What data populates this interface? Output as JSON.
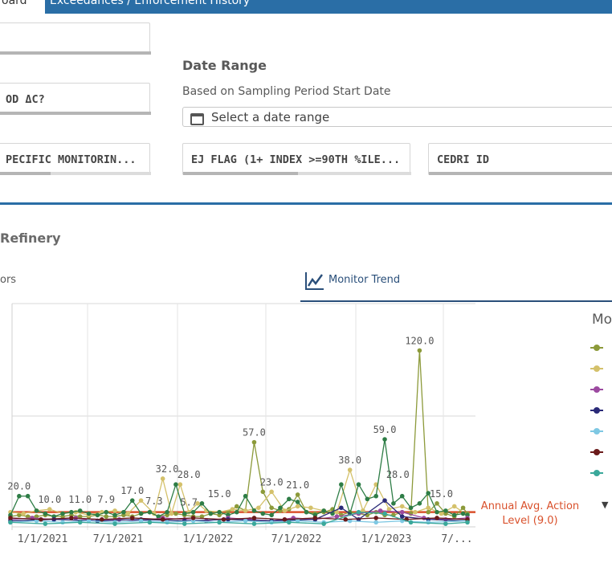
{
  "header": {
    "tab_active": "oard",
    "tab_next": "Exceedances / Enforcement History",
    "accent_color": "#2a6ea6"
  },
  "filters": {
    "box1_label": "",
    "box2_label": "OD ΔC?",
    "box3_label": "PECIFIC MONITORIN...",
    "box4_label": "EJ FLAG (1+ INDEX >=90TH %ILE...",
    "box5_label": "CEDRI ID"
  },
  "date_range": {
    "title": "Date Range",
    "subtitle": "Based on Sampling Period Start Date",
    "placeholder": "Select a date range",
    "icon": "calendar-icon"
  },
  "section": {
    "title": "Refinery",
    "tab_left": "ors",
    "tab_trend": "Monitor Trend",
    "tab_trend_icon": "line-chart-icon"
  },
  "legend": {
    "title": "Mo",
    "items": [
      {
        "color": "#8c9a3a"
      },
      {
        "color": "#d4c16b"
      },
      {
        "color": "#9c4aa0"
      },
      {
        "color": "#2a2a78"
      },
      {
        "color": "#7ec8e3"
      },
      {
        "color": "#6b1a1a"
      },
      {
        "color": "#3aa89a"
      }
    ],
    "more_icon": "caret-down-icon"
  },
  "chart_data": {
    "type": "line",
    "ylim": [
      0,
      150
    ],
    "x_tick_labels": [
      "1/1/2021",
      "7/1/2021",
      "1/1/2022",
      "7/1/2022",
      "1/1/2023",
      "7/..."
    ],
    "reference_line": {
      "label_line1": "Annual Avg. Action",
      "label_line2": "Level (9.0)",
      "value": 9.0,
      "color": "#d9512c"
    },
    "series": [
      {
        "color": "#8c9a3a",
        "values": [
          [
            0,
            6
          ],
          [
            2,
            7
          ],
          [
            4,
            6
          ],
          [
            6,
            6
          ],
          [
            8,
            7
          ],
          [
            10,
            6
          ],
          [
            12,
            6
          ],
          [
            14,
            7
          ],
          [
            16,
            6
          ],
          [
            18,
            6
          ],
          [
            20,
            7
          ],
          [
            22,
            6
          ],
          [
            24,
            6
          ],
          [
            26,
            7
          ],
          [
            28,
            6
          ],
          [
            30,
            8
          ],
          [
            32,
            9
          ],
          [
            34,
            6
          ],
          [
            36,
            7
          ],
          [
            38,
            8
          ],
          [
            40,
            7
          ],
          [
            42,
            6
          ],
          [
            44,
            6
          ],
          [
            46,
            8
          ],
          [
            48,
            7
          ],
          [
            50,
            9
          ],
          [
            52,
            13
          ],
          [
            54,
            10
          ],
          [
            56,
            57
          ],
          [
            58,
            23
          ],
          [
            60,
            12
          ],
          [
            62,
            10
          ],
          [
            64,
            11
          ],
          [
            66,
            21
          ],
          [
            68,
            9
          ],
          [
            70,
            8
          ],
          [
            72,
            9
          ],
          [
            74,
            11
          ],
          [
            76,
            7
          ],
          [
            78,
            9
          ],
          [
            80,
            8
          ],
          [
            82,
            7
          ],
          [
            84,
            9
          ],
          [
            86,
            7
          ],
          [
            88,
            7
          ],
          [
            90,
            9
          ],
          [
            92,
            8
          ],
          [
            94,
            120
          ],
          [
            96,
            9
          ],
          [
            98,
            15
          ],
          [
            100,
            8
          ],
          [
            102,
            6
          ],
          [
            104,
            12
          ],
          [
            105,
            8
          ]
        ]
      },
      {
        "color": "#d4c16b",
        "values": [
          [
            0,
            9
          ],
          [
            3,
            8
          ],
          [
            6,
            10
          ],
          [
            9,
            11
          ],
          [
            12,
            8
          ],
          [
            15,
            9
          ],
          [
            18,
            7
          ],
          [
            21,
            9
          ],
          [
            24,
            10
          ],
          [
            27,
            8
          ],
          [
            30,
            17
          ],
          [
            33,
            8
          ],
          [
            35,
            32
          ],
          [
            37,
            8
          ],
          [
            39,
            28
          ],
          [
            41,
            9
          ],
          [
            43,
            15
          ],
          [
            45,
            10
          ],
          [
            48,
            9
          ],
          [
            51,
            11
          ],
          [
            54,
            10
          ],
          [
            57,
            12
          ],
          [
            60,
            23
          ],
          [
            63,
            10
          ],
          [
            66,
            13
          ],
          [
            69,
            12
          ],
          [
            72,
            10
          ],
          [
            75,
            9
          ],
          [
            78,
            38
          ],
          [
            81,
            10
          ],
          [
            84,
            28
          ],
          [
            87,
            11
          ],
          [
            90,
            13
          ],
          [
            93,
            9
          ],
          [
            96,
            12
          ],
          [
            99,
            8
          ],
          [
            102,
            13
          ],
          [
            105,
            7
          ]
        ]
      },
      {
        "color": "#2e7d46",
        "values": [
          [
            0,
            7
          ],
          [
            2,
            20
          ],
          [
            4,
            20
          ],
          [
            6,
            10
          ],
          [
            8,
            8
          ],
          [
            10,
            6
          ],
          [
            12,
            8
          ],
          [
            14,
            9
          ],
          [
            16,
            10
          ],
          [
            18,
            8
          ],
          [
            20,
            7
          ],
          [
            22,
            9
          ],
          [
            24,
            7
          ],
          [
            26,
            9
          ],
          [
            28,
            17
          ],
          [
            30,
            8
          ],
          [
            32,
            9
          ],
          [
            34,
            6
          ],
          [
            36,
            9
          ],
          [
            38,
            28
          ],
          [
            40,
            8
          ],
          [
            42,
            9
          ],
          [
            44,
            15
          ],
          [
            46,
            8
          ],
          [
            48,
            9
          ],
          [
            50,
            7
          ],
          [
            52,
            9
          ],
          [
            54,
            20
          ],
          [
            56,
            10
          ],
          [
            58,
            8
          ],
          [
            60,
            7
          ],
          [
            62,
            12
          ],
          [
            64,
            18
          ],
          [
            66,
            16
          ],
          [
            68,
            9
          ],
          [
            70,
            7
          ],
          [
            72,
            10
          ],
          [
            74,
            8
          ],
          [
            76,
            28
          ],
          [
            78,
            8
          ],
          [
            80,
            28
          ],
          [
            82,
            18
          ],
          [
            84,
            20
          ],
          [
            86,
            59
          ],
          [
            88,
            15
          ],
          [
            90,
            20
          ],
          [
            92,
            12
          ],
          [
            94,
            15
          ],
          [
            96,
            22
          ],
          [
            98,
            9
          ],
          [
            100,
            10
          ],
          [
            102,
            7
          ],
          [
            104,
            8
          ],
          [
            105,
            7
          ]
        ]
      },
      {
        "color": "#9c4aa0",
        "values": [
          [
            0,
            4
          ],
          [
            5,
            5
          ],
          [
            10,
            4
          ],
          [
            15,
            5
          ],
          [
            20,
            3
          ],
          [
            25,
            4
          ],
          [
            30,
            3
          ],
          [
            35,
            5
          ],
          [
            40,
            4
          ],
          [
            45,
            3
          ],
          [
            50,
            5
          ],
          [
            55,
            4
          ],
          [
            60,
            3
          ],
          [
            65,
            5
          ],
          [
            70,
            4
          ],
          [
            75,
            6
          ],
          [
            80,
            8
          ],
          [
            85,
            10
          ],
          [
            90,
            9
          ],
          [
            95,
            5
          ],
          [
            100,
            4
          ],
          [
            105,
            5
          ]
        ]
      },
      {
        "color": "#2a2a78",
        "values": [
          [
            0,
            3
          ],
          [
            10,
            4
          ],
          [
            20,
            3
          ],
          [
            30,
            4
          ],
          [
            40,
            3
          ],
          [
            50,
            4
          ],
          [
            60,
            3
          ],
          [
            70,
            4
          ],
          [
            76,
            12
          ],
          [
            80,
            4
          ],
          [
            86,
            17
          ],
          [
            90,
            6
          ],
          [
            96,
            4
          ],
          [
            105,
            3
          ]
        ]
      },
      {
        "color": "#7ec8e3",
        "values": [
          [
            0,
            2
          ],
          [
            6,
            3
          ],
          [
            12,
            2
          ],
          [
            18,
            3
          ],
          [
            24,
            2
          ],
          [
            30,
            3
          ],
          [
            36,
            2
          ],
          [
            42,
            3
          ],
          [
            48,
            2
          ],
          [
            54,
            3
          ],
          [
            60,
            2
          ],
          [
            66,
            3
          ],
          [
            72,
            2
          ],
          [
            78,
            3
          ],
          [
            84,
            2
          ],
          [
            90,
            3
          ],
          [
            96,
            2
          ],
          [
            105,
            3
          ]
        ]
      },
      {
        "color": "#6b1a1a",
        "values": [
          [
            0,
            5
          ],
          [
            7,
            4
          ],
          [
            14,
            5
          ],
          [
            21,
            4
          ],
          [
            28,
            5
          ],
          [
            35,
            4
          ],
          [
            42,
            5
          ],
          [
            49,
            4
          ],
          [
            56,
            5
          ],
          [
            63,
            4
          ],
          [
            70,
            5
          ],
          [
            77,
            4
          ],
          [
            84,
            5
          ],
          [
            91,
            4
          ],
          [
            98,
            5
          ],
          [
            105,
            4
          ]
        ]
      },
      {
        "color": "#3aa89a",
        "values": [
          [
            0,
            2
          ],
          [
            8,
            1
          ],
          [
            16,
            2
          ],
          [
            24,
            1
          ],
          [
            32,
            2
          ],
          [
            40,
            1
          ],
          [
            48,
            2
          ],
          [
            56,
            1
          ],
          [
            64,
            2
          ],
          [
            72,
            1
          ],
          [
            80,
            9
          ],
          [
            86,
            8
          ],
          [
            92,
            2
          ],
          [
            100,
            1
          ],
          [
            105,
            2
          ]
        ]
      }
    ],
    "data_labels": [
      {
        "x": 2,
        "y": 20,
        "text": "20.0"
      },
      {
        "x": 9,
        "y": 11,
        "text": "10.0"
      },
      {
        "x": 16,
        "y": 11,
        "text": "11.0"
      },
      {
        "x": 22,
        "y": 11,
        "text": "7.9"
      },
      {
        "x": 28,
        "y": 17,
        "text": "17.0"
      },
      {
        "x": 33,
        "y": 10,
        "text": "7.3"
      },
      {
        "x": 36,
        "y": 32,
        "text": "32.0"
      },
      {
        "x": 41,
        "y": 28,
        "text": "28.0"
      },
      {
        "x": 41,
        "y": 9,
        "text": "5.7"
      },
      {
        "x": 48,
        "y": 15,
        "text": "15.0"
      },
      {
        "x": 56,
        "y": 57,
        "text": "57.0"
      },
      {
        "x": 60,
        "y": 23,
        "text": "23.0"
      },
      {
        "x": 66,
        "y": 21,
        "text": "21.0"
      },
      {
        "x": 78,
        "y": 38,
        "text": "38.0"
      },
      {
        "x": 86,
        "y": 59,
        "text": "59.0"
      },
      {
        "x": 89,
        "y": 28,
        "text": "28.0"
      },
      {
        "x": 94,
        "y": 120,
        "text": "120.0"
      },
      {
        "x": 99,
        "y": 15,
        "text": "15.0"
      }
    ]
  }
}
